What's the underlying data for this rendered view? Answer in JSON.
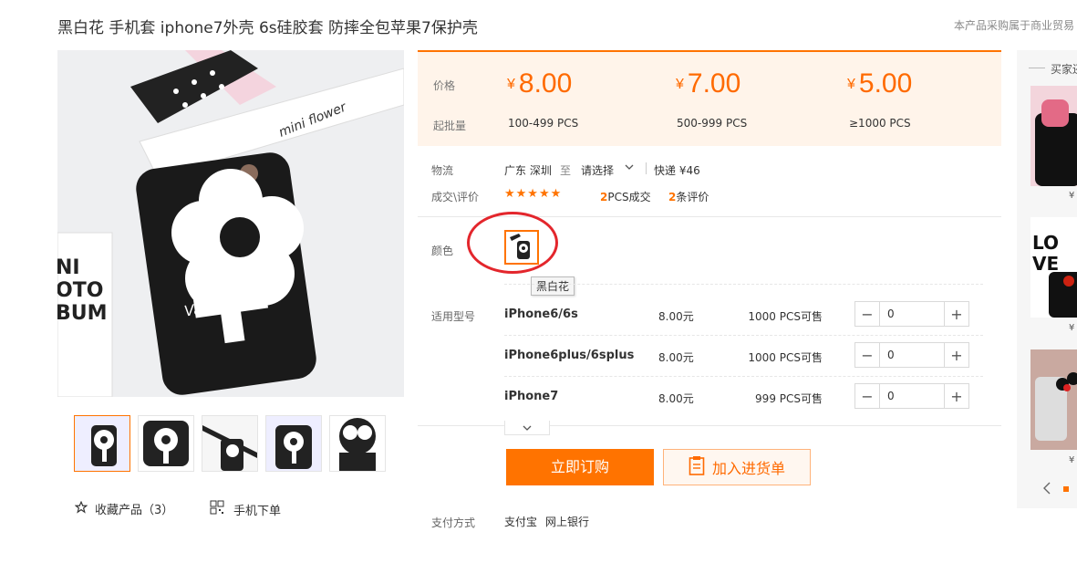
{
  "product": {
    "title": "黑白花 手机套 iphone7外壳 6s硅胶套 防摔全包苹果7保护壳",
    "notice": "本产品采购属于商业贸易"
  },
  "colors": {
    "accent": "#ff7300",
    "price_bg": "#fff4ea",
    "highlight": "#e3262c"
  },
  "price_panel": {
    "price_label": "价格",
    "moq_label": "起批量",
    "currency": "¥",
    "tiers": [
      {
        "price": "8.00",
        "qty": "100-499 PCS"
      },
      {
        "price": "7.00",
        "qty": "500-999 PCS"
      },
      {
        "price": "5.00",
        "qty": "≥1000 PCS"
      }
    ]
  },
  "logistics": {
    "label": "物流",
    "from": "广东 深圳",
    "to_word": "至",
    "destination": "请选择",
    "shipping": "快递 ¥46"
  },
  "deals": {
    "label": "成交\\评价",
    "stars": "★★★★★",
    "rating": 5,
    "sold_count": "2",
    "sold_text": "PCS成交",
    "review_count": "2",
    "review_text": "条评价"
  },
  "color_option": {
    "label": "颜色",
    "selected": "黑白花"
  },
  "models": {
    "label": "适用型号",
    "rows": [
      {
        "name": "iPhone6/6s",
        "price": "8.00元",
        "stock": "1000 PCS可售",
        "qty": "0"
      },
      {
        "name": "iPhone6plus/6splus",
        "price": "8.00元",
        "stock": "1000 PCS可售",
        "qty": "0"
      },
      {
        "name": "iPhone7",
        "price": "8.00元",
        "stock": "999 PCS可售",
        "qty": "0"
      }
    ]
  },
  "actions": {
    "buy": "立即订购",
    "add_to_list": "加入进货单",
    "favorite": "收藏产品（3）",
    "mobile_order": "手机下单"
  },
  "payment": {
    "label": "支付方式",
    "methods": [
      "支付宝",
      "网上银行"
    ]
  },
  "sidebar": {
    "title": "买家还",
    "prices": [
      "¥",
      "¥",
      "¥"
    ]
  },
  "icons": [
    "star-outline-icon",
    "qrcode-icon",
    "clipboard-icon",
    "chevron-down-icon",
    "minus-icon",
    "plus-icon",
    "chevron-left-icon"
  ]
}
